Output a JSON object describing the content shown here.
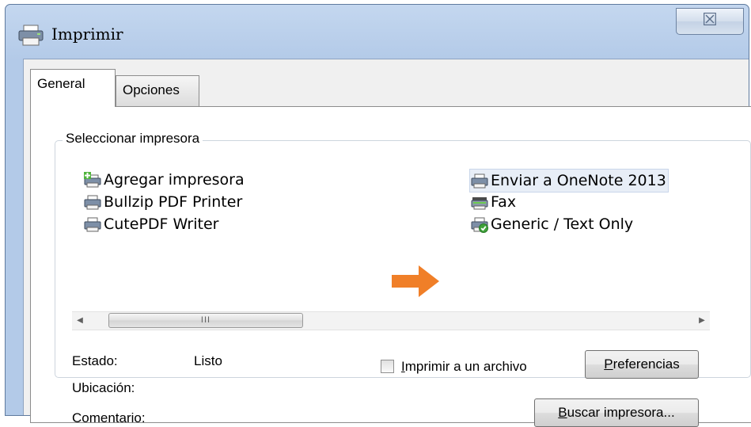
{
  "window": {
    "title": "Imprimir",
    "close_glyph": "☒"
  },
  "tabs": [
    {
      "label": "General",
      "active": true
    },
    {
      "label": "Opciones",
      "active": false
    }
  ],
  "group": {
    "title": "Seleccionar impresora"
  },
  "printers": [
    {
      "name": "Agregar impresora",
      "icon": "add-printer-icon"
    },
    {
      "name": "Bullzip PDF Printer",
      "icon": "printer-icon"
    },
    {
      "name": "CutePDF Writer",
      "icon": "printer-icon"
    },
    {
      "name": "Enviar a OneNote 2013",
      "icon": "printer-icon",
      "selected": true
    },
    {
      "name": "Fax",
      "icon": "fax-icon"
    },
    {
      "name": "Generic / Text Only",
      "icon": "default-printer-icon"
    }
  ],
  "scrollbar": {
    "left_glyph": "◀",
    "right_glyph": "▶",
    "thumb_grip": "III"
  },
  "status": {
    "estado_label": "Estado:",
    "estado_value": "Listo",
    "ubicacion_label": "Ubicación:",
    "comentario_label": "Comentario:"
  },
  "print_to_file": {
    "label_mnemonic": "I",
    "label_rest": "mprimir a un archivo",
    "checked": false
  },
  "buttons": {
    "preferencias_mnemonic": "P",
    "preferencias_rest": "referencias",
    "buscar_mnemonic": "B",
    "buscar_rest": "uscar impresora..."
  },
  "colors": {
    "arrow": "#f07f28",
    "selection": "#e8eef7",
    "titlebar": "#c4d7ef"
  }
}
